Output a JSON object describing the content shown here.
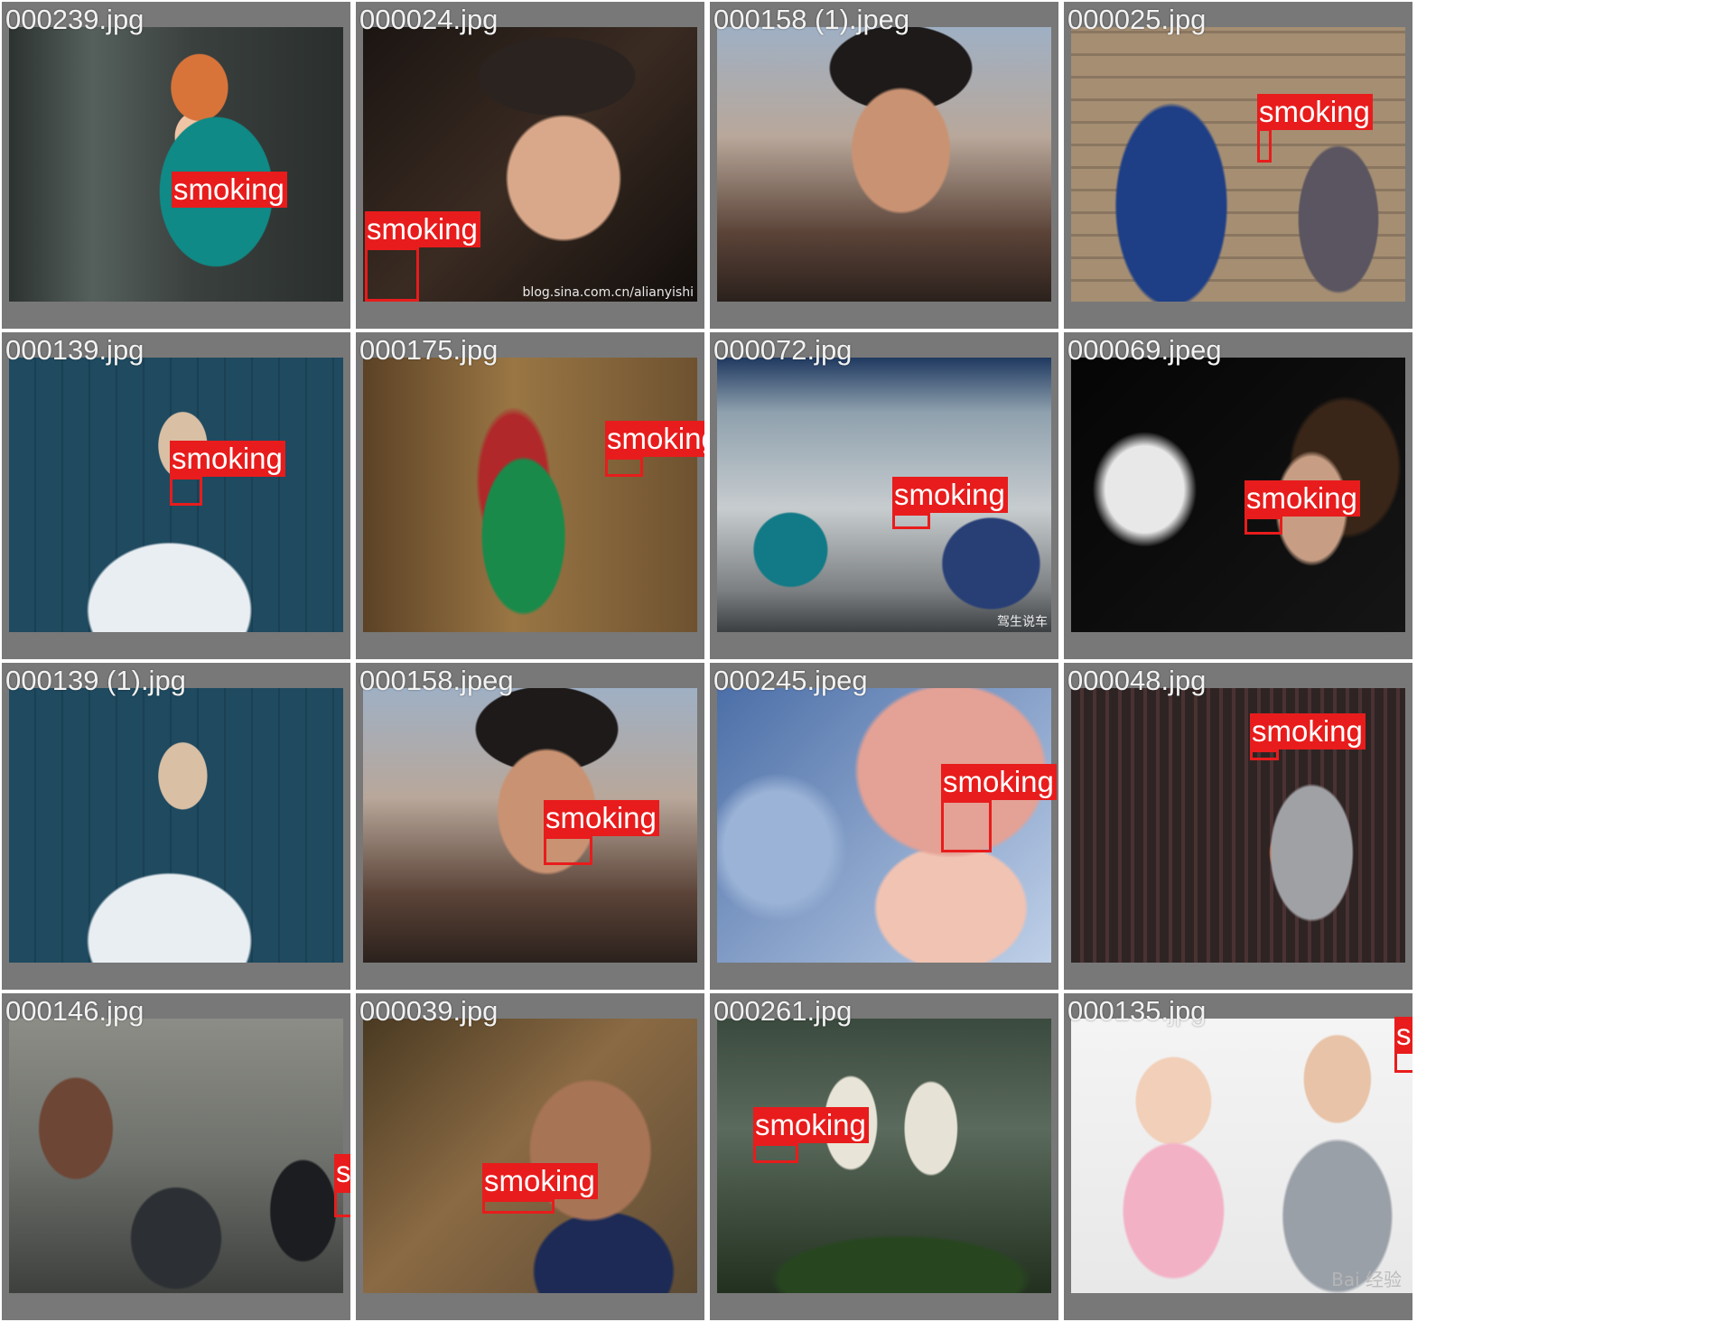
{
  "label_color": "#e81c1c",
  "tile_bg": "#787878",
  "tiles": [
    {
      "filename": "000239.jpg",
      "scene": "street",
      "detections": [
        {
          "label": "smoking"
        }
      ]
    },
    {
      "filename": "000024.jpg",
      "scene": "dark",
      "watermark": "blog.sina.com.cn/alianyishi",
      "detections": [
        {
          "label": "smoking"
        }
      ]
    },
    {
      "filename": "000158 (1).jpeg",
      "scene": "warm",
      "detections": []
    },
    {
      "filename": "000025.jpg",
      "scene": "brick",
      "detections": [
        {
          "label": "smoking"
        }
      ]
    },
    {
      "filename": "000139.jpg",
      "scene": "blue",
      "detections": [
        {
          "label": "smoking"
        }
      ]
    },
    {
      "filename": "000175.jpg",
      "scene": "amber",
      "detections": [
        {
          "label": "smoking"
        }
      ]
    },
    {
      "filename": "000072.jpg",
      "scene": "car",
      "watermark": "驾生说车",
      "detections": [
        {
          "label": "smoking"
        }
      ]
    },
    {
      "filename": "000069.jpeg",
      "scene": "black",
      "detections": [
        {
          "label": "smoking"
        }
      ]
    },
    {
      "filename": "000139 (1).jpg",
      "scene": "blue",
      "detections": []
    },
    {
      "filename": "000158.jpeg",
      "scene": "warm",
      "detections": [
        {
          "label": "smoking"
        }
      ]
    },
    {
      "filename": "000245.jpeg",
      "scene": "closeup",
      "detections": [
        {
          "label": "smoking"
        }
      ]
    },
    {
      "filename": "000048.jpg",
      "scene": "cafe",
      "detections": [
        {
          "label": "smoking"
        }
      ]
    },
    {
      "filename": "000146.jpg",
      "scene": "crowd",
      "detections": [
        {
          "label": "smoking"
        }
      ]
    },
    {
      "filename": "000039.jpg",
      "scene": "old",
      "detections": [
        {
          "label": "smoking"
        }
      ]
    },
    {
      "filename": "000261.jpg",
      "scene": "plants",
      "detections": [
        {
          "label": "smoking"
        }
      ]
    },
    {
      "filename": "000135.jpg",
      "scene": "white",
      "watermark": "Bai 经验",
      "detections": [
        {
          "label": "smokin"
        }
      ]
    }
  ]
}
